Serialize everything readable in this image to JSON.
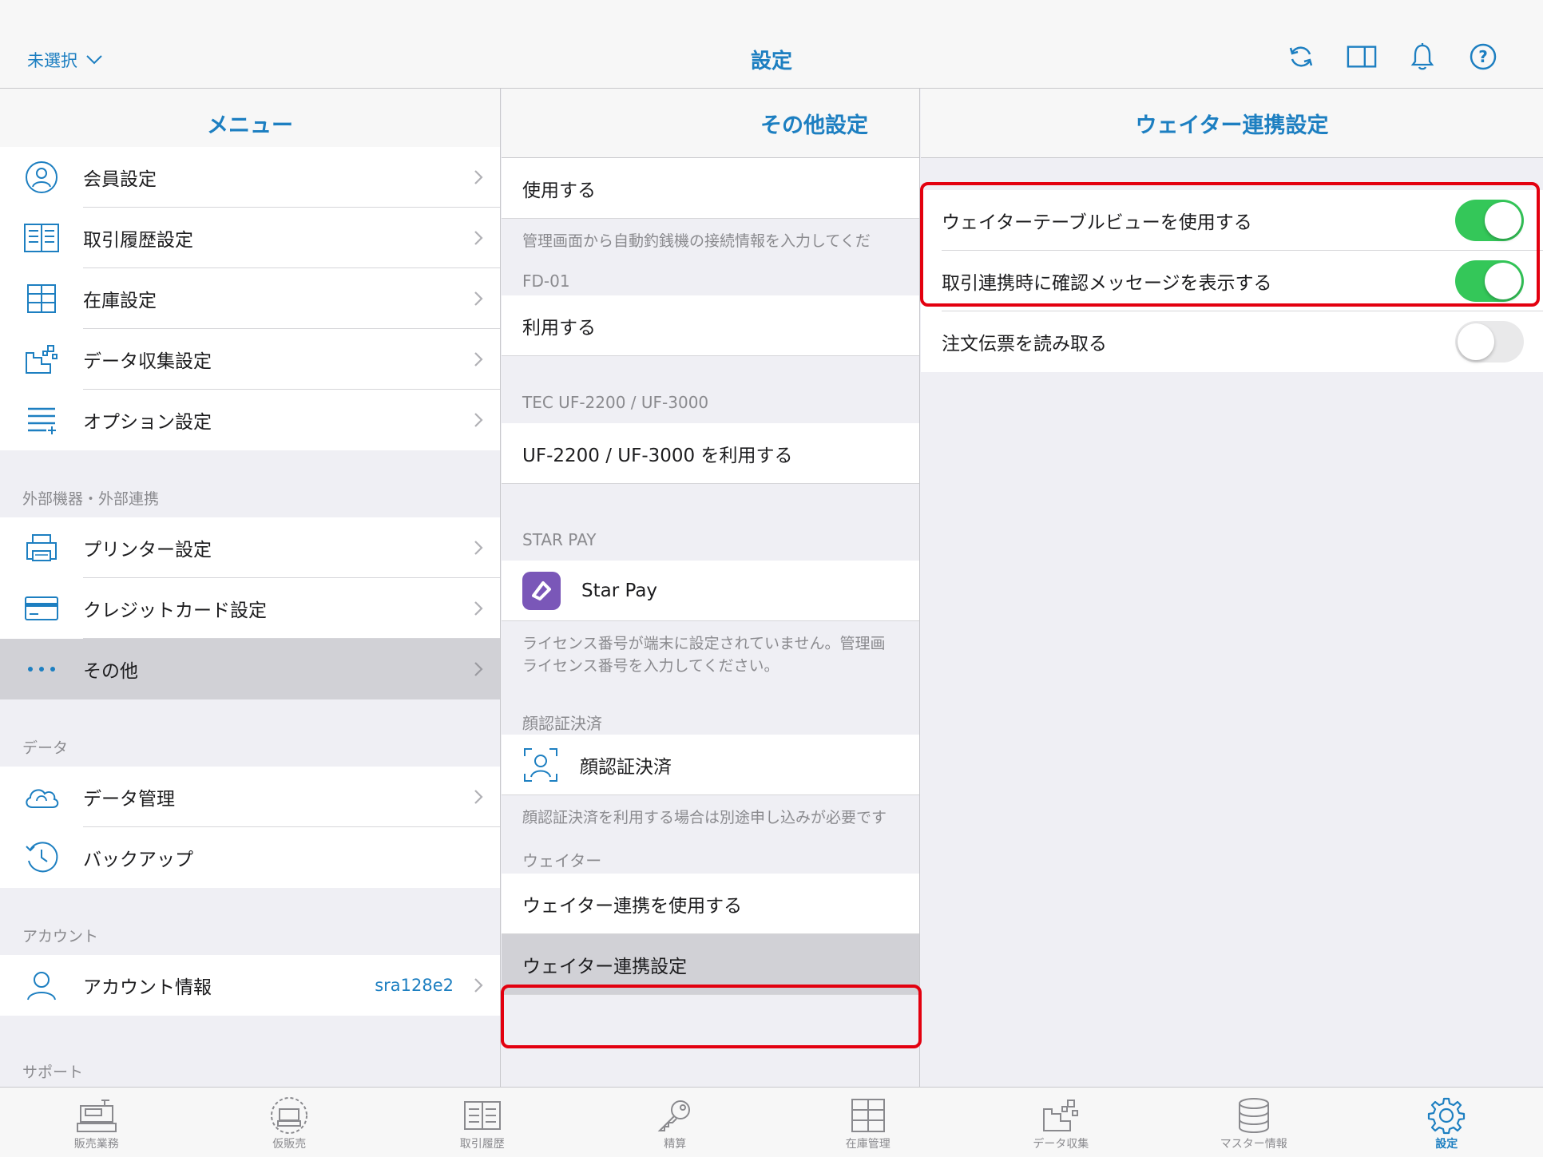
{
  "topbar": {
    "left_label": "未選択",
    "title": "設定",
    "icons": [
      "refresh-icon",
      "split-view-icon",
      "bell-icon",
      "help-icon"
    ]
  },
  "menu": {
    "title": "メニュー",
    "top_items": [
      {
        "label": "会員設定",
        "icon": "member-icon"
      },
      {
        "label": "取引履歴設定",
        "icon": "history-icon"
      },
      {
        "label": "在庫設定",
        "icon": "inventory-icon"
      },
      {
        "label": "データ収集設定",
        "icon": "data-collection-icon"
      },
      {
        "label": "オプション設定",
        "icon": "option-icon"
      }
    ],
    "section_external": "外部機器・外部連携",
    "external_items": [
      {
        "label": "プリンター設定",
        "icon": "printer-icon"
      },
      {
        "label": "クレジットカード設定",
        "icon": "credit-card-icon"
      },
      {
        "label": "その他",
        "icon": "more-icon"
      }
    ],
    "section_data": "データ",
    "data_items": [
      {
        "label": "データ管理",
        "icon": "cloud-icon"
      },
      {
        "label": "バックアップ",
        "icon": "backup-icon"
      }
    ],
    "section_account": "アカウント",
    "account_item": {
      "label": "アカウント情報",
      "value": "sra128e2"
    },
    "section_support": "サポート"
  },
  "other": {
    "title": "その他設定",
    "row_use": "使用する",
    "note_changer": "管理画面から自動釣銭機の接続情報を入力してくだ",
    "section_fd": "FD-01",
    "row_fd": "利用する",
    "section_tec": "TEC UF-2200 / UF-3000",
    "row_tec": "UF-2200 / UF-3000 を利用する",
    "section_starpay": "STAR PAY",
    "row_starpay": "Star Pay",
    "note_starpay_1": "ライセンス番号が端末に設定されていません。管理画",
    "note_starpay_2": "ライセンス番号を入力してください。",
    "section_face": "顔認証決済",
    "row_face": "顔認証決済",
    "note_face": "顔認証決済を利用する場合は別途申し込みが必要です",
    "section_waiter": "ウェイター",
    "row_waiter_use": "ウェイター連携を使用する",
    "row_waiter_settings": "ウェイター連携設定"
  },
  "waiter": {
    "title": "ウェイター連携設定",
    "rows": [
      {
        "label": "ウェイターテーブルビューを使用する",
        "on": true
      },
      {
        "label": "取引連携時に確認メッセージを表示する",
        "on": true
      },
      {
        "label": "注文伝票を読み取る",
        "on": false
      }
    ]
  },
  "tabbar": {
    "tabs": [
      {
        "label": "販売業務",
        "icon": "register-icon"
      },
      {
        "label": "仮販売",
        "icon": "provisional-sale-icon"
      },
      {
        "label": "取引履歴",
        "icon": "transaction-history-icon"
      },
      {
        "label": "精算",
        "icon": "key-icon"
      },
      {
        "label": "在庫管理",
        "icon": "inventory-management-icon"
      },
      {
        "label": "データ収集",
        "icon": "data-collection-icon"
      },
      {
        "label": "マスター情報",
        "icon": "database-icon"
      },
      {
        "label": "設定",
        "icon": "gear-icon"
      }
    ],
    "active_index": 7
  },
  "colors": {
    "accent": "#1d7fc1",
    "toggle_on": "#34c759",
    "highlight": "#e3000f"
  }
}
